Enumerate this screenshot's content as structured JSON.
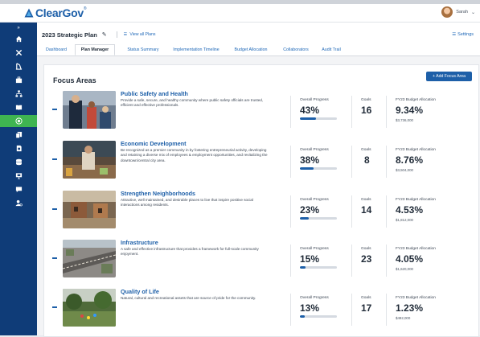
{
  "app": {
    "logo_text": "ClearGov",
    "user_name": "Sarah"
  },
  "colors": {
    "sidebar": "#0f3c78",
    "sidebar_active": "#3fb551",
    "accent": "#1d5fa8",
    "link": "#2069b8"
  },
  "header": {
    "plan_title": "2023 Strategic Plan",
    "view_all": "View all Plans",
    "settings": "Settings"
  },
  "sidebar": {
    "expand_glyph": "»",
    "items": [
      {
        "icon": "home-icon"
      },
      {
        "icon": "tools-icon"
      },
      {
        "icon": "scale-icon"
      },
      {
        "icon": "briefcase-icon"
      },
      {
        "icon": "org-chart-icon"
      },
      {
        "icon": "book-icon"
      },
      {
        "icon": "target-icon",
        "active": true
      },
      {
        "icon": "document-copy-icon"
      },
      {
        "icon": "document-chart-icon"
      },
      {
        "icon": "database-icon"
      },
      {
        "icon": "presentation-icon"
      },
      {
        "icon": "chat-icon"
      },
      {
        "icon": "user-settings-icon"
      }
    ]
  },
  "tabs": [
    {
      "label": "Dashboard"
    },
    {
      "label": "Plan Manager",
      "active": true
    },
    {
      "label": "Status Summary"
    },
    {
      "label": "Implementation Timeline"
    },
    {
      "label": "Budget Allocation"
    },
    {
      "label": "Collaborators"
    },
    {
      "label": "Audit Trail"
    }
  ],
  "focus_areas": {
    "title": "Focus Areas",
    "add_button": "+ Add Focus Area",
    "progress_label": "Overall Progress",
    "goals_label": "Goals",
    "budget_label": "FY23 Budget Allocation",
    "items": [
      {
        "name": "Public Safety and Health",
        "description": "Provide a safe, secure, and healthy community where public safety officials are trusted, efficient and effective professionals.",
        "progress": "43%",
        "progress_value": 0.43,
        "goals": "16",
        "budget_pct": "9.34%",
        "budget_amount": "$3,736,000"
      },
      {
        "name": "Economic Development",
        "description": "Be recognized as a premier community in by fostering entrepreneurial activity, developing and retaining a diverse mix of employees & employment opportunities, and revitalizing the downtown/central city area.",
        "progress": "38%",
        "progress_value": 0.38,
        "goals": "8",
        "budget_pct": "8.76%",
        "budget_amount": "$3,504,000"
      },
      {
        "name": "Strengthen Neighborhoods",
        "description": "Attractive, well maintained, and desirable places to live that inspire positive social interactions among residents.",
        "progress": "23%",
        "progress_value": 0.23,
        "goals": "14",
        "budget_pct": "4.53%",
        "budget_amount": "$1,812,000"
      },
      {
        "name": "Infrastructure",
        "description": "A safe and effective infrastructure that provides a framework for full-scale community enjoyment.",
        "progress": "15%",
        "progress_value": 0.15,
        "goals": "23",
        "budget_pct": "4.05%",
        "budget_amount": "$1,620,000"
      },
      {
        "name": "Quality of Life",
        "description": "Natural, cultural and recreational assets that are source of pride for the community.",
        "progress": "13%",
        "progress_value": 0.13,
        "goals": "17",
        "budget_pct": "1.23%",
        "budget_amount": "$492,000"
      }
    ]
  }
}
